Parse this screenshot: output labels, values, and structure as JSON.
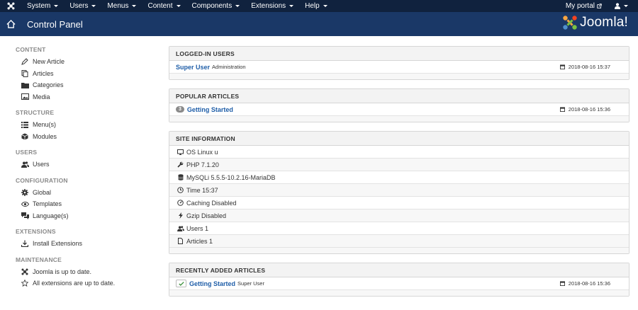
{
  "topnav": {
    "menu": [
      {
        "label": "System"
      },
      {
        "label": "Users"
      },
      {
        "label": "Menus"
      },
      {
        "label": "Content"
      },
      {
        "label": "Components"
      },
      {
        "label": "Extensions"
      },
      {
        "label": "Help"
      }
    ],
    "portal_label": "My portal"
  },
  "header": {
    "title": "Control Panel",
    "brand": "Joomla!"
  },
  "sidebar": {
    "groups": [
      {
        "heading": "CONTENT",
        "items": [
          {
            "label": "New Article",
            "icon": "pencil-icon"
          },
          {
            "label": "Articles",
            "icon": "copy-icon"
          },
          {
            "label": "Categories",
            "icon": "folder-icon"
          },
          {
            "label": "Media",
            "icon": "image-icon"
          }
        ]
      },
      {
        "heading": "STRUCTURE",
        "items": [
          {
            "label": "Menu(s)",
            "icon": "list-icon"
          },
          {
            "label": "Modules",
            "icon": "cube-icon"
          }
        ]
      },
      {
        "heading": "USERS",
        "items": [
          {
            "label": "Users",
            "icon": "users-icon"
          }
        ]
      },
      {
        "heading": "CONFIGURATION",
        "items": [
          {
            "label": "Global",
            "icon": "cog-icon"
          },
          {
            "label": "Templates",
            "icon": "eye-icon"
          },
          {
            "label": "Language(s)",
            "icon": "comments-icon"
          }
        ]
      },
      {
        "heading": "EXTENSIONS",
        "items": [
          {
            "label": "Install Extensions",
            "icon": "upload-icon"
          }
        ]
      },
      {
        "heading": "MAINTENANCE",
        "items": [
          {
            "label": "Joomla is up to date.",
            "icon": "joomla-icon"
          },
          {
            "label": "All extensions are up to date.",
            "icon": "star-icon"
          }
        ]
      }
    ]
  },
  "panels": {
    "logged_in": {
      "title": "LOGGED-IN USERS",
      "rows": [
        {
          "name": "Super User",
          "sub": "Administration",
          "date": "2018-08-16 15:37"
        }
      ]
    },
    "popular": {
      "title": "POPULAR ARTICLES",
      "rows": [
        {
          "hits": "3",
          "name": "Getting Started",
          "date": "2018-08-16 15:36"
        }
      ]
    },
    "site_info": {
      "title": "SITE INFORMATION",
      "rows": [
        {
          "label": "OS Linux u",
          "icon": "monitor-icon"
        },
        {
          "label": "PHP 7.1.20",
          "icon": "wrench-icon"
        },
        {
          "label": "MySQLi 5.5.5-10.2.16-MariaDB",
          "icon": "database-icon"
        },
        {
          "label": "Time 15:37",
          "icon": "clock-icon"
        },
        {
          "label": "Caching Disabled",
          "icon": "dashboard-icon"
        },
        {
          "label": "Gzip Disabled",
          "icon": "lightning-icon"
        },
        {
          "label": "Users 1",
          "icon": "users-icon"
        },
        {
          "label": "Articles 1",
          "icon": "file-icon"
        }
      ]
    },
    "recent": {
      "title": "RECENTLY ADDED ARTICLES",
      "rows": [
        {
          "name": "Getting Started",
          "sub": "Super User",
          "date": "2018-08-16 15:36"
        }
      ]
    }
  }
}
